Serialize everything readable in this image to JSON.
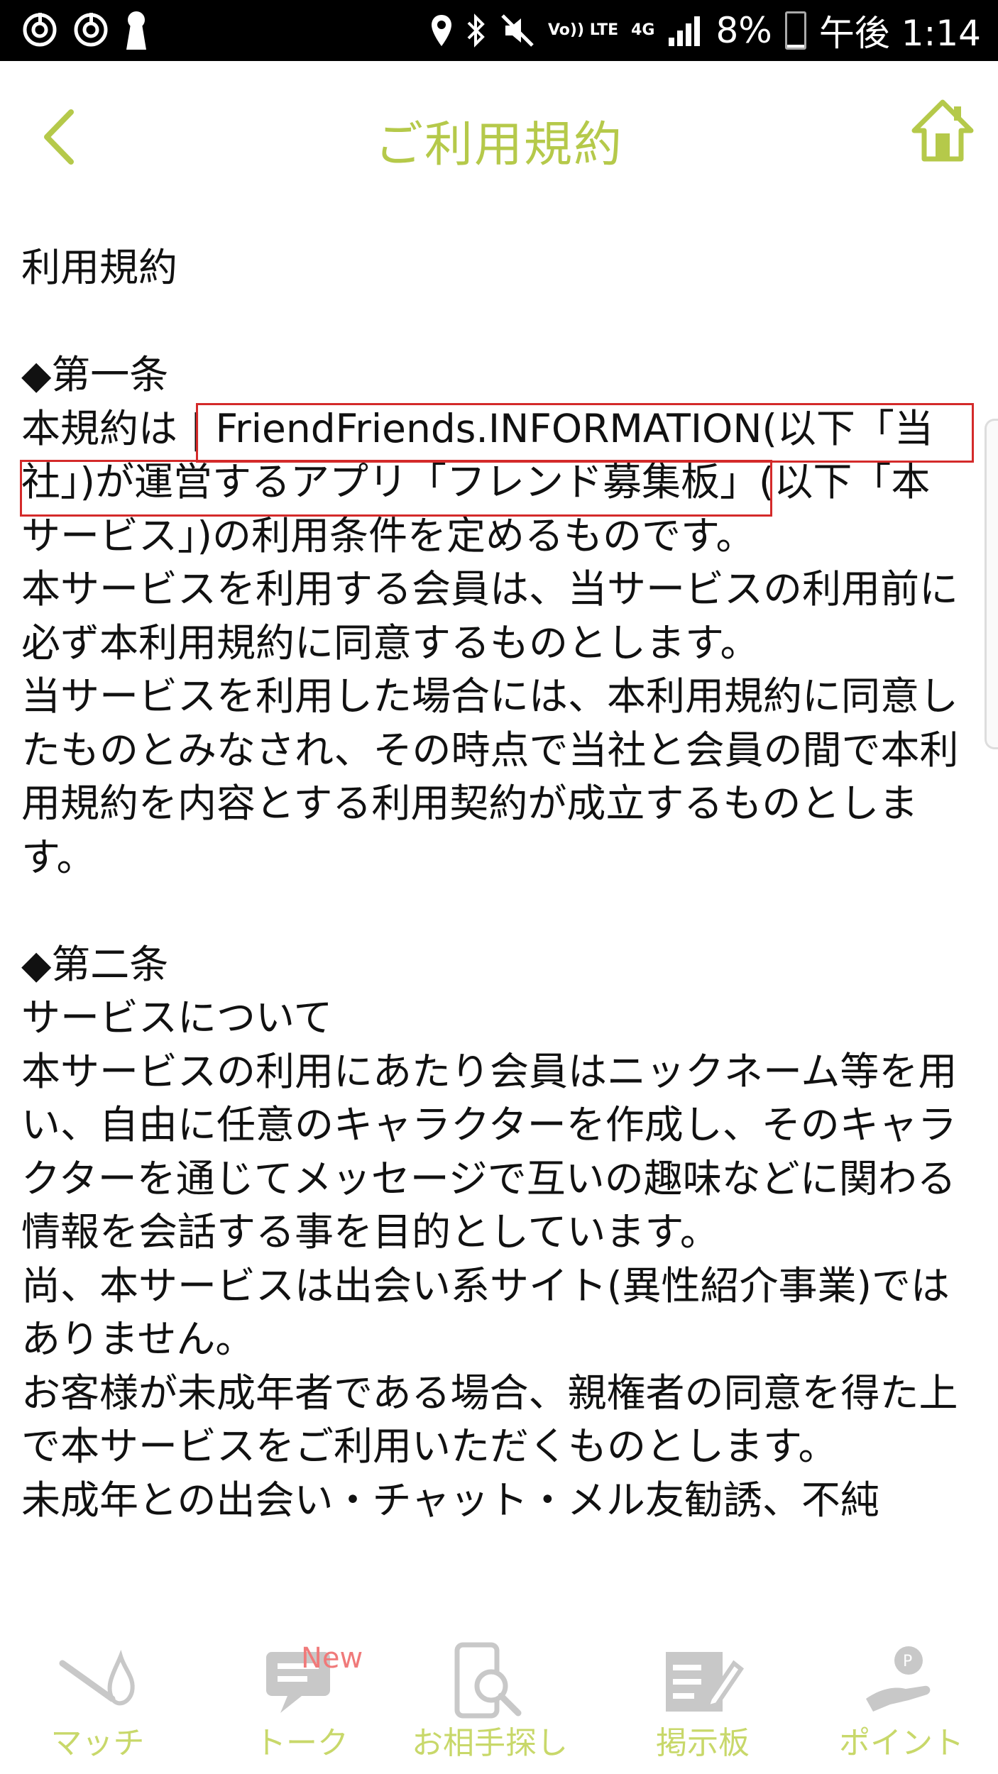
{
  "status_bar": {
    "network": [
      "Vo)) LTE",
      "4G"
    ],
    "battery": "8%",
    "time": "午後 1:14",
    "battery_level": 0.08
  },
  "header": {
    "title": "ご利用規約",
    "back_icon": "chevron-left-icon",
    "home_icon": "home-icon",
    "accent": "#b5c94a"
  },
  "content": {
    "paragraphs": [
      "利用規約",
      "",
      "◆第一条",
      "本規約は | FriendFriends.INFORMATION(以下「当社」)が運営するアプリ「フレンド募集板」(以下「本サービス」)の利用条件を定めるものです。",
      "本サービスを利用する会員は、当サービスの利用前に必ず本利用規約に同意するものとします。",
      "当サービスを利用した場合には、本利用規約に同意したものとみなされ、その時点で当社と会員の間で本利用規約を内容とする利用契約が成立するものとします。",
      "",
      "◆第二条",
      "サービスについて",
      "本サービスの利用にあたり会員はニックネーム等を用い、自由に任意のキャラクターを作成し、そのキャラクターを通じてメッセージで互いの趣味などに関わる情報を会話する事を目的としています。",
      "尚、本サービスは出会い系サイト(異性紹介事業)ではありません。",
      "お客様が未成年者である場合、親権者の同意を得た上で本サービスをご利用いただくものとします。",
      "未成年との出会い・チャット・メル友勧誘、不純"
    ]
  },
  "bottom_nav": {
    "items": [
      {
        "label": "マッチ",
        "icon": "match-icon"
      },
      {
        "label": "トーク",
        "icon": "chat-icon"
      },
      {
        "label": "お相手探し",
        "icon": "search-phone-icon"
      },
      {
        "label": "掲示板",
        "icon": "board-icon"
      },
      {
        "label": "ポイント",
        "icon": "point-icon"
      }
    ],
    "badge": "New",
    "label_color": "#c8d86a",
    "icon_color": "#c8c8c8"
  }
}
